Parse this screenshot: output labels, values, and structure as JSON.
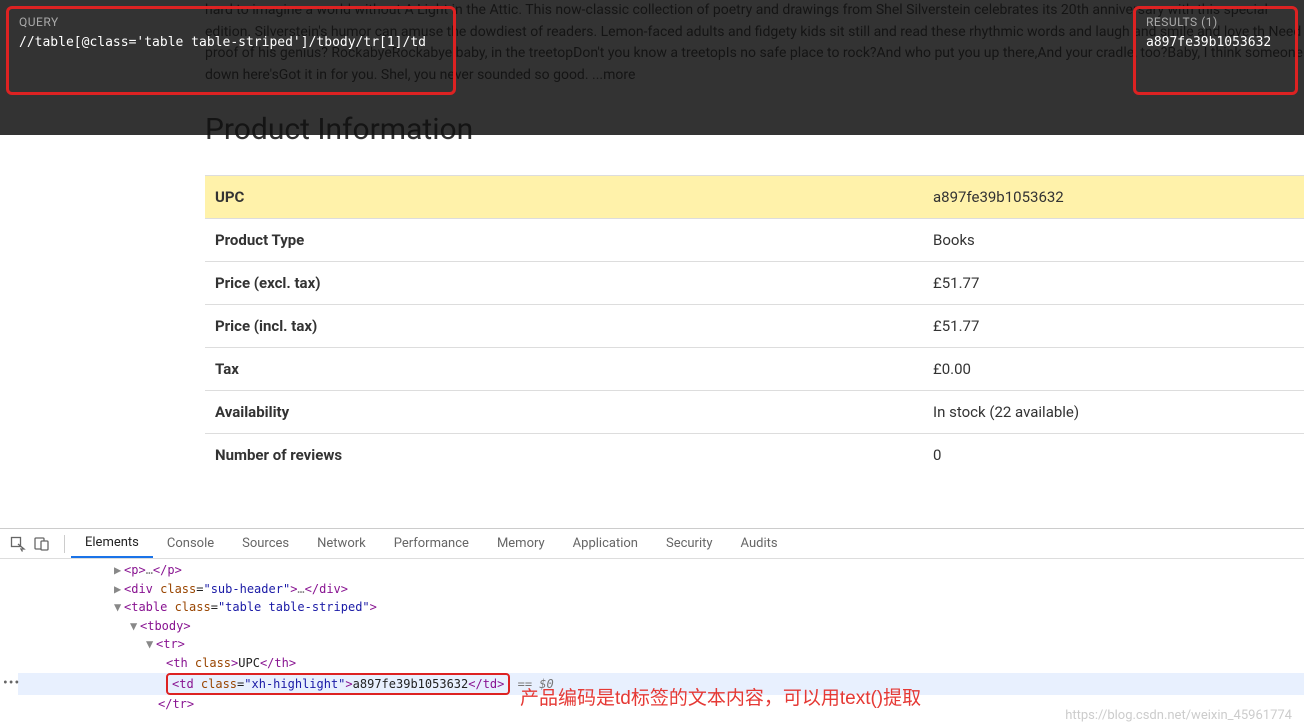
{
  "query": {
    "label": "QUERY",
    "value": "//table[@class='table table-striped']/tbody/tr[1]/td"
  },
  "results": {
    "label": "RESULTS (1)",
    "value": "a897fe39b1053632"
  },
  "description": "hard to imagine a world without A Light in the Attic. This now-classic collection of poetry and drawings from Shel Silverstein celebrates its 20th anniversary with this special edition. Silverstein's humor can amuse the dowdiest of readers. Lemon-faced adults and fidgety kids sit still and read these rhythmic words and laugh and smile and love th Need proof of his genius? RockabyeRockabye baby, in the treetopDon't you know a treetopIs no safe place to rock?And who put you up there,And your cradle, too?Baby, I think someone down here'sGot it in for you. Shel, you never sounded so good. ...more",
  "section_title": "Product Information",
  "table": {
    "rows": [
      {
        "label": "UPC",
        "value": "a897fe39b1053632"
      },
      {
        "label": "Product Type",
        "value": "Books"
      },
      {
        "label": "Price (excl. tax)",
        "value": "£51.77"
      },
      {
        "label": "Price (incl. tax)",
        "value": "£51.77"
      },
      {
        "label": "Tax",
        "value": "£0.00"
      },
      {
        "label": "Availability",
        "value": "In stock (22 available)"
      },
      {
        "label": "Number of reviews",
        "value": "0"
      }
    ]
  },
  "devtools": {
    "tabs": [
      "Elements",
      "Console",
      "Sources",
      "Network",
      "Performance",
      "Memory",
      "Application",
      "Security",
      "Audits"
    ],
    "active_tab": "Elements",
    "dom": {
      "l1": "<p>…</p>",
      "l2_open": "<div ",
      "l2_attr": "class",
      "l2_val": "\"sub-header\"",
      "l2_mid": ">…</div>",
      "l3_open": "<table ",
      "l3_attr": "class",
      "l3_val": "\"table table-striped\"",
      "l3_close": ">",
      "l4": "<tbody>",
      "l5": "<tr>",
      "l6_open": "<th ",
      "l6_attr": "class",
      "l6_close": ">UPC</th>",
      "l7_open": "<td ",
      "l7_attr": "class",
      "l7_val": "\"xh-highlight\"",
      "l7_text": ">a897fe39b1053632</td>",
      "l7_suffix": " == $0",
      "l8": "</tr>"
    }
  },
  "annotation": "产品编码是td标签的文本内容，可以用text()提取",
  "watermark": "https://blog.csdn.net/weixin_45961774"
}
